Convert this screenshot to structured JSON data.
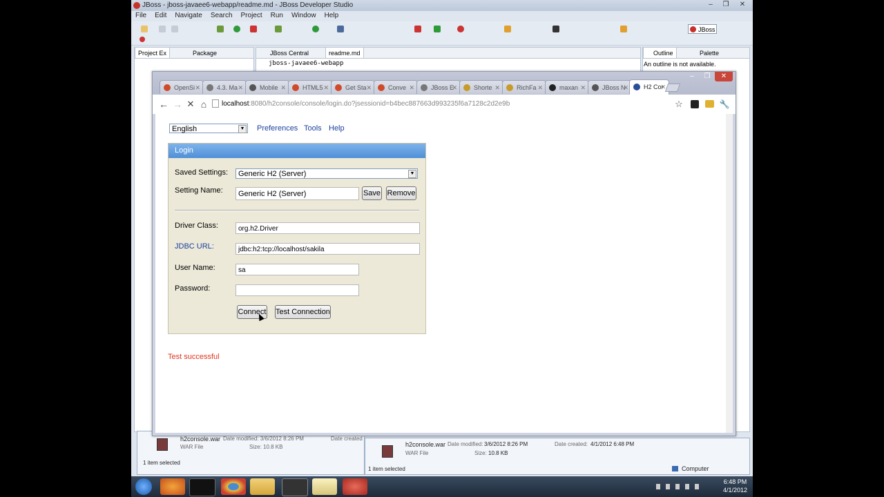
{
  "ide": {
    "title": "JBoss - jboss-javaee6-webapp/readme.md - JBoss Developer Studio",
    "menu": [
      "File",
      "Edit",
      "Navigate",
      "Search",
      "Project",
      "Run",
      "Window",
      "Help"
    ],
    "perspective": "JBoss",
    "views_left": [
      "Project Ex",
      "Package"
    ],
    "editor_tabs": [
      "JBoss Central",
      "readme.md"
    ],
    "editor_breadcrumb": "jboss-javaee6-webapp",
    "views_right": [
      "Outline",
      "Palette"
    ],
    "outline_message": "An outline is not available."
  },
  "explorer_left": {
    "file_name": "h2console.war",
    "type": "WAR File",
    "date_modified": "Date modified: 3/6/2012 8:26 PM",
    "date_created_label": "Date created",
    "size": "Size: 10.8 KB",
    "status": "1 item selected"
  },
  "explorer_right": {
    "file_name": "h2console.war",
    "type": "WAR File",
    "date_modified_label": "Date modified:",
    "date_modified": "3/6/2012 8:26 PM",
    "date_created_label": "Date created:",
    "date_created": "4/1/2012 6:48 PM",
    "size_label": "Size:",
    "size": "10.8 KB",
    "status": "1 item selected",
    "location": "Computer"
  },
  "browser": {
    "tabs": [
      {
        "label": "OpenSi",
        "color": "#d04a2a"
      },
      {
        "label": "4.3. Ma",
        "color": "#777777"
      },
      {
        "label": "Mobile",
        "color": "#555555"
      },
      {
        "label": "HTML5",
        "color": "#d04a2a"
      },
      {
        "label": "Get Sta",
        "color": "#d04a2a"
      },
      {
        "label": "Conve",
        "color": "#d04a2a"
      },
      {
        "label": "JBoss E",
        "color": "#777777"
      },
      {
        "label": "Shorte",
        "color": "#c79a2a"
      },
      {
        "label": "RichFa",
        "color": "#c79a2a"
      },
      {
        "label": "maxan",
        "color": "#222222"
      },
      {
        "label": "JBoss N",
        "color": "#555555"
      },
      {
        "label": "H2 Cor",
        "color": "#2a4f9a"
      }
    ],
    "url_host": "localhost",
    "url_path": ":8080/h2console/console/login.do?jsessionid=b4bec887663d993235f6a7128c2d2e9b"
  },
  "h2": {
    "language": "English",
    "links": [
      "Preferences",
      "Tools",
      "Help"
    ],
    "login_title": "Login",
    "saved_settings_label": "Saved Settings:",
    "saved_settings_value": "Generic H2 (Server)",
    "setting_name_label": "Setting Name:",
    "setting_name_value": "Generic H2 (Server)",
    "save_label": "Save",
    "remove_label": "Remove",
    "driver_class_label": "Driver Class:",
    "driver_class_value": "org.h2.Driver",
    "jdbc_url_label": "JDBC URL:",
    "jdbc_url_value": "jdbc:h2:tcp://localhost/sakila",
    "user_name_label": "User Name:",
    "user_name_value": "sa",
    "password_label": "Password:",
    "password_value": "",
    "connect_label": "Connect",
    "test_connection_label": "Test Connection",
    "test_result": "Test successful",
    "colors": {
      "header": "#4f8fd8",
      "panel": "#ece9d8",
      "link": "#1a3f9e",
      "success": "#e0341e"
    }
  },
  "taskbar": {
    "time": "6:48 PM",
    "date": "4/1/2012"
  }
}
